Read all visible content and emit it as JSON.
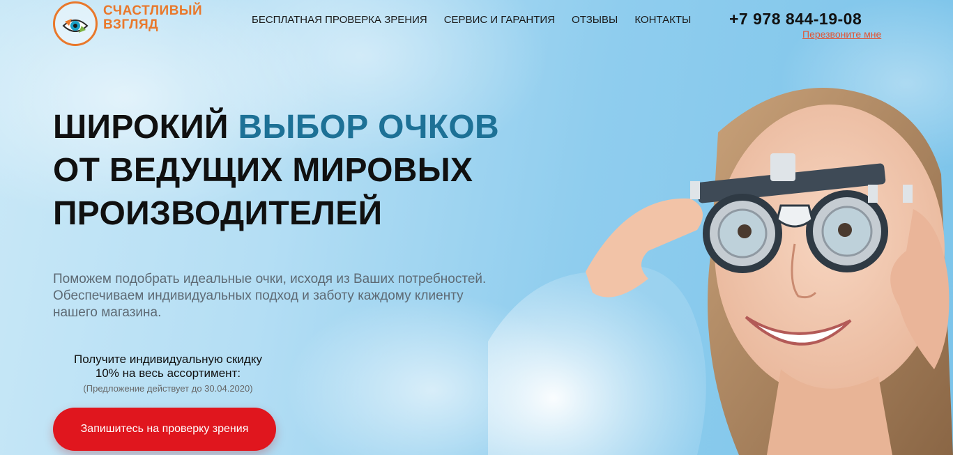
{
  "header": {
    "logo_line1": "СЧАСТЛИВЫЙ",
    "logo_line2": "ВЗГЛЯД",
    "nav": [
      {
        "label": "БЕСПЛАТНАЯ ПРОВЕРКА ЗРЕНИЯ"
      },
      {
        "label": "СЕРВИС И ГАРАНТИЯ"
      },
      {
        "label": "ОТЗЫВЫ"
      },
      {
        "label": "КОНТАКТЫ"
      }
    ],
    "phone": "+7 978 844-19-08",
    "callback": "Перезвоните мне"
  },
  "hero": {
    "headline_part1": "ШИРОКИЙ ",
    "headline_accent": "ВЫБОР ОЧКОВ",
    "headline_line2": "ОТ ВЕДУЩИХ МИРОВЫХ",
    "headline_line3": "ПРОИЗВОДИТЕЛЕЙ",
    "description_line1": "Поможем подобрать идеальные очки, исходя из Ваших потребностей.",
    "description_line2": "Обеспечиваем индивидуальных подход и заботу каждому клиенту",
    "description_line3": "нашего магазина.",
    "offer_line1": "Получите индивидуальную скидку",
    "offer_line2": "10% на весь ассортимент:",
    "offer_note": "(Предложение действует до 30.04.2020)",
    "cta_label": "Запишитесь на проверку зрения"
  },
  "colors": {
    "brand_orange": "#e9782b",
    "accent_blue": "#1d7196",
    "cta_red": "#e0161e",
    "callback_link": "#e05535"
  },
  "icons": {
    "logo": "eye-logo-icon"
  }
}
